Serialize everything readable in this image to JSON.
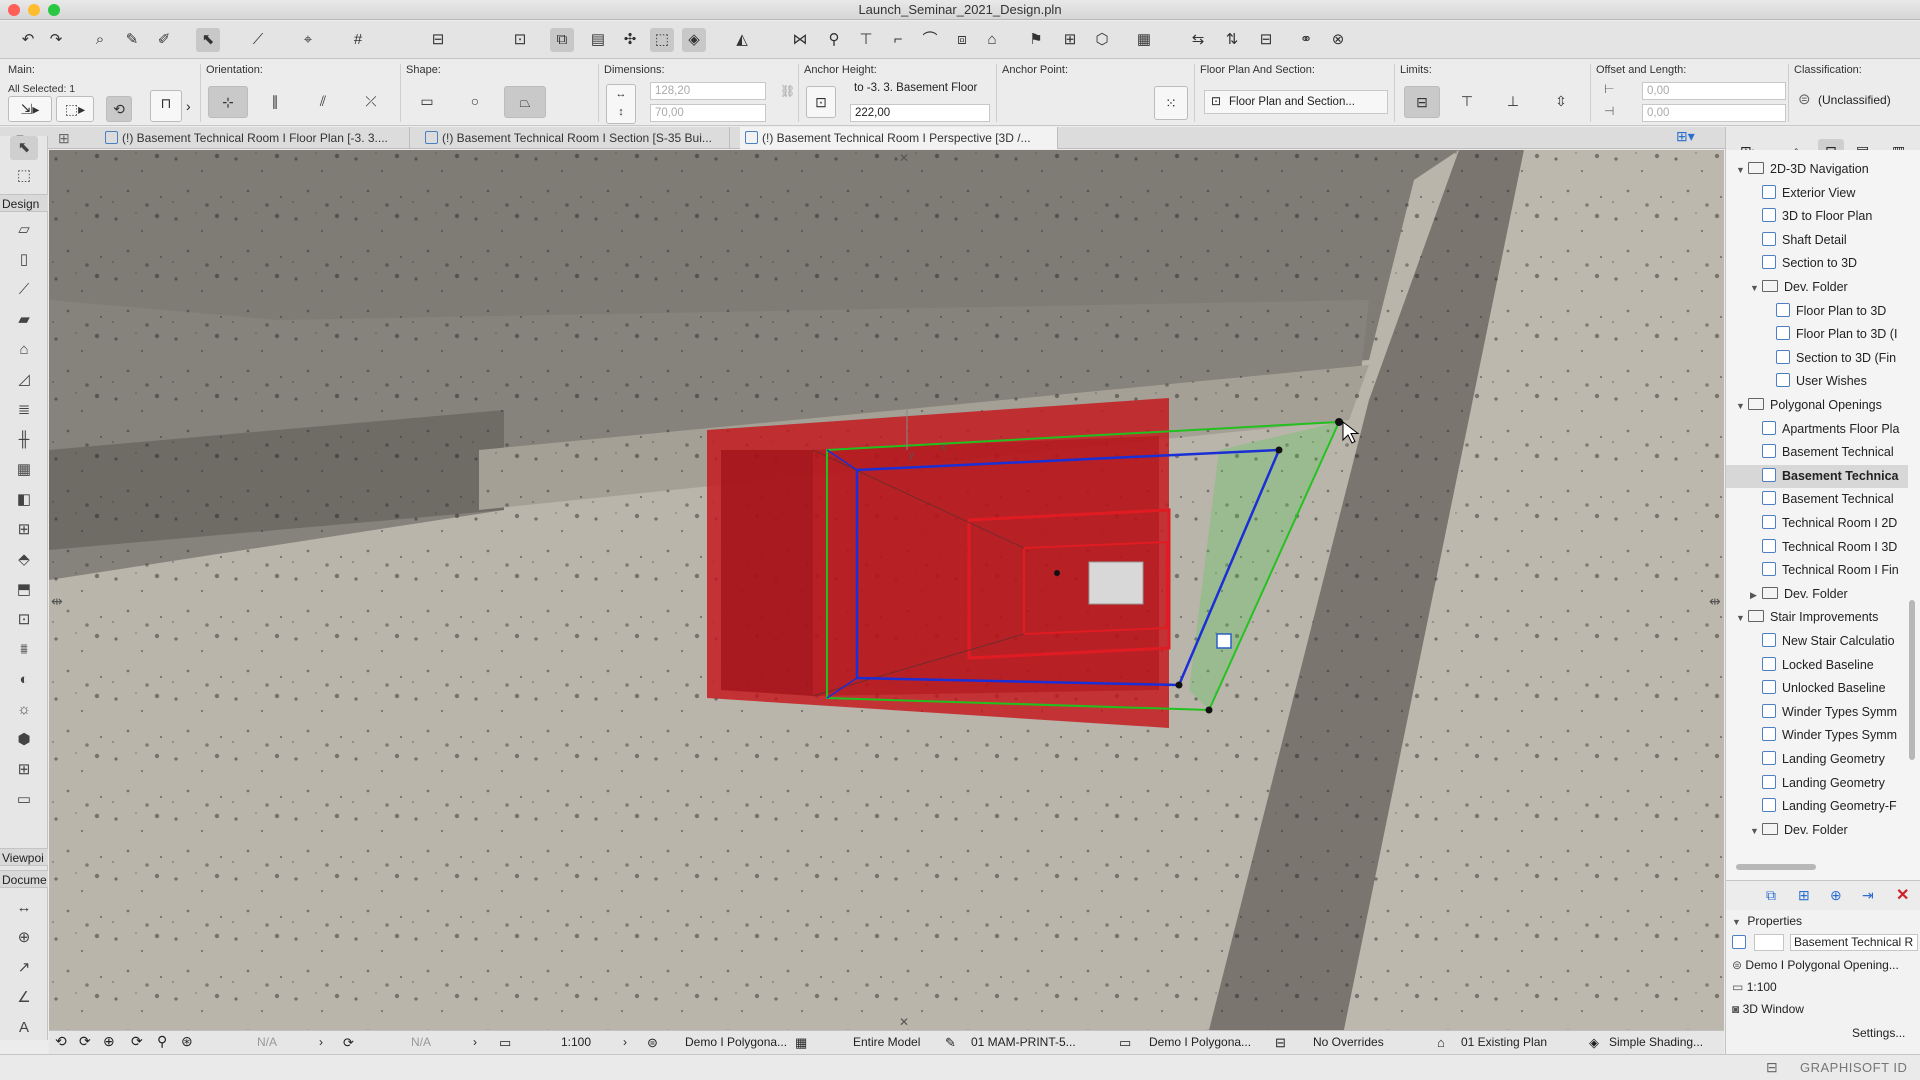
{
  "window": {
    "title": "Launch_Seminar_2021_Design.pln"
  },
  "infobox": {
    "main_label": "Main:",
    "selection_label": "All Selected: 1",
    "orientation_label": "Orientation:",
    "shape_label": "Shape:",
    "dimensions_label": "Dimensions:",
    "width_value": "128,20",
    "height_value": "70,00",
    "anchor_height_label": "Anchor Height:",
    "anchor_story": "to -3. 3. Basement Floor",
    "anchor_value": "222,00",
    "anchor_point_label": "Anchor Point:",
    "floor_plan_label": "Floor Plan And Section:",
    "floor_plan_button": "Floor Plan and Section...",
    "limits_label": "Limits:",
    "offset_label": "Offset and Length:",
    "offset_value": "0,00",
    "length_value": "0,00",
    "classification_label": "Classification:",
    "classification_value": "(Unclassified)"
  },
  "tabs": [
    {
      "label": "(!) Basement Technical Room I Floor Plan [-3. 3...."
    },
    {
      "label": "(!) Basement Technical Room I Section [S-35 Bui..."
    },
    {
      "label": "(!) Basement Technical Room I Perspective [3D /..."
    }
  ],
  "toolbox": {
    "design": "Design",
    "viewpoint": "Viewpoi",
    "document": "Docume"
  },
  "navigator": {
    "items": [
      {
        "label": "2D-3D Navigation",
        "type": "folder",
        "level": 0,
        "expanded": true
      },
      {
        "label": "Exterior View",
        "type": "view",
        "level": 1
      },
      {
        "label": "3D to Floor Plan",
        "type": "view",
        "level": 1
      },
      {
        "label": "Shaft Detail",
        "type": "view",
        "level": 1
      },
      {
        "label": "Section to 3D",
        "type": "view",
        "level": 1
      },
      {
        "label": "Dev. Folder",
        "type": "folder",
        "level": 1,
        "expanded": true
      },
      {
        "label": "Floor Plan to 3D",
        "type": "view",
        "level": 2
      },
      {
        "label": "Floor Plan to 3D (I",
        "type": "view",
        "level": 2
      },
      {
        "label": "Section to 3D (Fin",
        "type": "view",
        "level": 2
      },
      {
        "label": "User Wishes",
        "type": "view",
        "level": 2
      },
      {
        "label": "Polygonal Openings",
        "type": "folder",
        "level": 0,
        "expanded": true
      },
      {
        "label": "Apartments Floor Pla",
        "type": "view",
        "level": 1
      },
      {
        "label": "Basement Technical",
        "type": "view",
        "level": 1
      },
      {
        "label": "Basement Technica",
        "type": "view",
        "level": 1,
        "selected": true
      },
      {
        "label": "Basement Technical",
        "type": "view",
        "level": 1
      },
      {
        "label": "Technical Room I 2D",
        "type": "view",
        "level": 1
      },
      {
        "label": "Technical Room I 3D",
        "type": "view",
        "level": 1
      },
      {
        "label": "Technical Room I Fin",
        "type": "view",
        "level": 1
      },
      {
        "label": "Dev. Folder",
        "type": "folder",
        "level": 1,
        "expanded": false
      },
      {
        "label": "Stair Improvements",
        "type": "folder",
        "level": 0,
        "expanded": true
      },
      {
        "label": "New Stair Calculatio",
        "type": "view",
        "level": 1
      },
      {
        "label": "Locked Baseline",
        "type": "view",
        "level": 1
      },
      {
        "label": "Unlocked Baseline",
        "type": "view",
        "level": 1
      },
      {
        "label": "Winder Types Symm",
        "type": "view",
        "level": 1
      },
      {
        "label": "Winder Types Symm",
        "type": "view",
        "level": 1
      },
      {
        "label": "Landing Geometry",
        "type": "view",
        "level": 1
      },
      {
        "label": "Landing Geometry",
        "type": "view",
        "level": 1
      },
      {
        "label": "Landing Geometry-F",
        "type": "view",
        "level": 1
      },
      {
        "label": "Dev. Folder",
        "type": "folder",
        "level": 1,
        "expanded": true
      }
    ]
  },
  "properties": {
    "header": "Properties",
    "name_value": "Basement Technical R",
    "source": "Demo I Polygonal Opening...",
    "scale": "1:100",
    "window_type": "3D Window",
    "settings_button": "Settings..."
  },
  "statusbar": {
    "na1": "N/A",
    "na2": "N/A",
    "scale": "1:100",
    "layer_combo": "Demo I Polygona...",
    "model": "Entire Model",
    "pen_set": "01 MAM-PRINT-5...",
    "mvo": "Demo I Polygona...",
    "overrides": "No Overrides",
    "renovation": "01 Existing Plan",
    "shading": "Simple Shading..."
  },
  "brand": "GRAPHISOFT ID",
  "colors": {
    "opening_red": "#c4161c",
    "edge_green": "#22c01e",
    "edge_blue": "#1a2fd6",
    "concrete": "#b9b4aa"
  }
}
